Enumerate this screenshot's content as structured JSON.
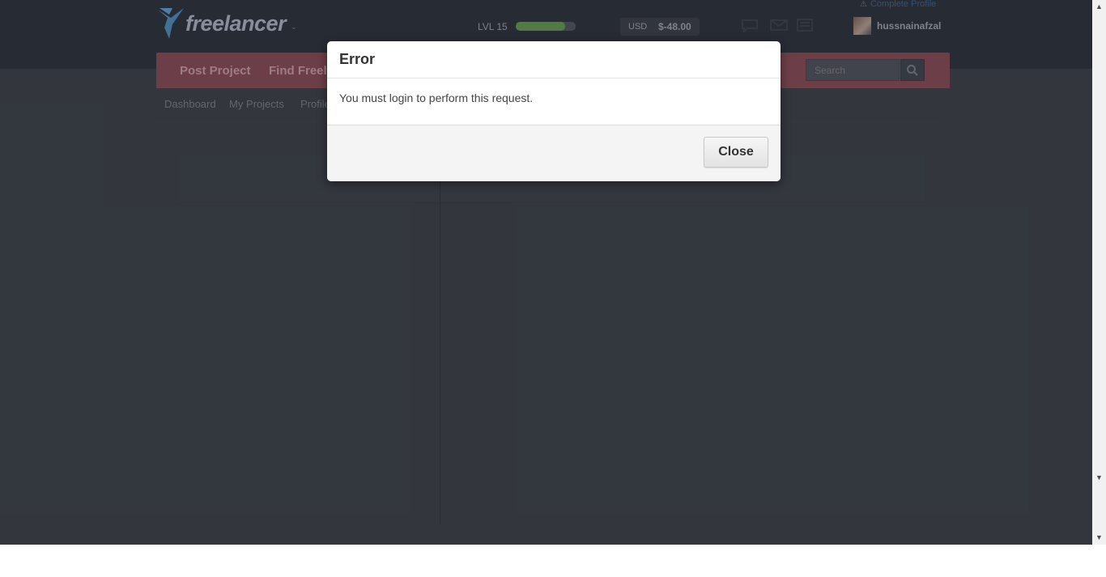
{
  "header": {
    "logo_text": "freelancer",
    "logo_caret": "⌄",
    "level_label": "LVL 15",
    "level_progress_percent": 82,
    "balance_currency": "USD",
    "balance_amount": "$-48.00",
    "notice_icon": "⚠",
    "notice_text": "Complete Profile",
    "username": "hussnainafzal"
  },
  "nav": {
    "items": [
      "Post Project",
      "Find Freelancers"
    ],
    "search_placeholder": "Search"
  },
  "subnav": {
    "items": [
      "Dashboard",
      "My Projects",
      "Profile"
    ]
  },
  "modal": {
    "title": "Error",
    "message": "You must login to perform this request.",
    "close_label": "Close"
  },
  "scrollbar": {
    "up_arrow": "▲",
    "down_arrow": "▼",
    "down_arrow_bottom": "▼"
  },
  "colors": {
    "page_background": "#393d44",
    "nav_brand": "#7a4650",
    "accent_green": "#5c8a4c"
  }
}
